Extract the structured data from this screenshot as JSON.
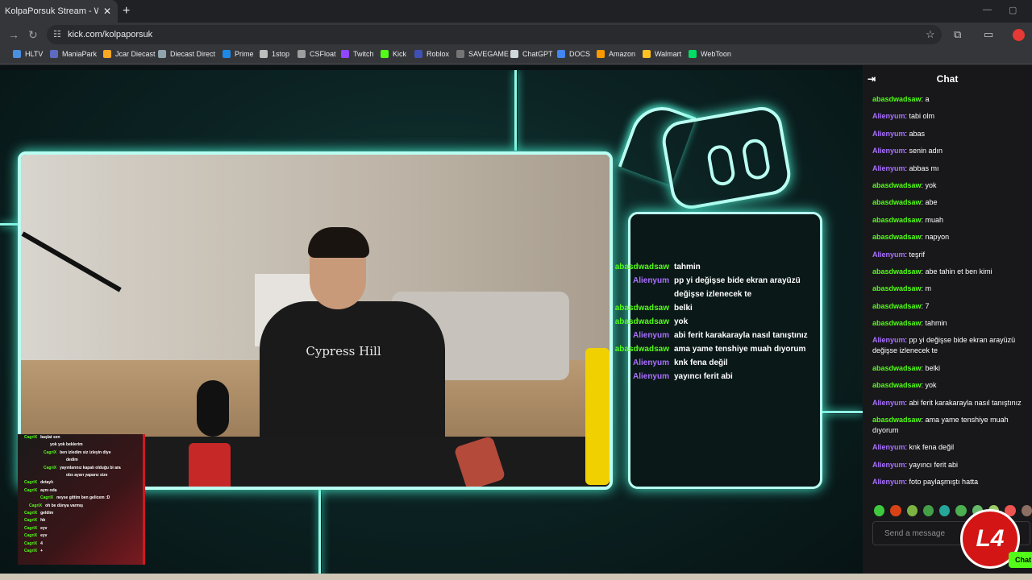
{
  "browser": {
    "tab_title": "KolpaPorsuk Stream - Watch Li",
    "new_tab_symbol": "+",
    "url": "kick.com/kolpaporsuk",
    "bookmarks": [
      {
        "label": "HLTV",
        "color": "#4a90e2"
      },
      {
        "label": "ManiaPark",
        "color": "#5c6bc0"
      },
      {
        "label": "Jcar Diecast",
        "color": "#f9a825"
      },
      {
        "label": "Diecast Direct",
        "color": "#90a4ae"
      },
      {
        "label": "Prime",
        "color": "#1e88e5"
      },
      {
        "label": "1stop",
        "color": "#bdbdbd"
      },
      {
        "label": "CSFloat",
        "color": "#9e9e9e"
      },
      {
        "label": "Twitch",
        "color": "#9146ff"
      },
      {
        "label": "Kick",
        "color": "#53fc18"
      },
      {
        "label": "Roblox",
        "color": "#3f51b5"
      },
      {
        "label": "SAVEGAME",
        "color": "#757575"
      },
      {
        "label": "ChatGPT",
        "color": "#cfd8dc"
      },
      {
        "label": "DOCS",
        "color": "#4285f4"
      },
      {
        "label": "Amazon",
        "color": "#ff9900"
      },
      {
        "label": "Walmart",
        "color": "#ffc220"
      },
      {
        "label": "WebToon",
        "color": "#00dc64"
      }
    ]
  },
  "stream": {
    "shirt_text": "Cypress Hill",
    "overlay_chat": [
      {
        "user": "abasdwadsaw",
        "color": "#53fc18",
        "msg": "tahmin"
      },
      {
        "user": "Alienyum",
        "color": "#a970ff",
        "msg": "pp yi değişse bide ekran arayüzü değişse izlenecek te"
      },
      {
        "user": "abasdwadsaw",
        "color": "#53fc18",
        "msg": "belki"
      },
      {
        "user": "abasdwadsaw",
        "color": "#53fc18",
        "msg": "yok"
      },
      {
        "user": "Alienyum",
        "color": "#a970ff",
        "msg": "abi ferit karakarayla nasıl tanıştınız"
      },
      {
        "user": "abasdwadsaw",
        "color": "#53fc18",
        "msg": "ama yame tenshiye muah dıyorum"
      },
      {
        "user": "Alienyum",
        "color": "#a970ff",
        "msg": "knk fena değil"
      },
      {
        "user": "Alienyum",
        "color": "#a970ff",
        "msg": "yayıncı ferit abi"
      }
    ],
    "mini_chat": [
      {
        "user": "CagriX",
        "msg": "başlat sen",
        "indent": 0
      },
      {
        "user": "",
        "msg": "yok yok beklerim",
        "indent": 28
      },
      {
        "user": "CagriX",
        "msg": "ben izledim siz izleyin diye",
        "indent": 24
      },
      {
        "user": "",
        "msg": "dedim",
        "indent": 48
      },
      {
        "user": "CagriX",
        "msg": "yayınlarınız kapalı olduğu bi ara",
        "indent": 24
      },
      {
        "user": "",
        "msg": "obs ayarı yaparız size",
        "indent": 48
      },
      {
        "user": "CagriX",
        "msg": "detaylı",
        "indent": 0
      },
      {
        "user": "CagriX",
        "msg": "aynı oda",
        "indent": 0
      },
      {
        "user": "CagriX",
        "msg": "neyse gittim ben gelicem :D",
        "indent": 20
      },
      {
        "user": "CagriX",
        "msg": "oh be dünya varmış",
        "indent": 6
      },
      {
        "user": "CagriX",
        "msg": "geldim",
        "indent": 0
      },
      {
        "user": "CagriX",
        "msg": "hb",
        "indent": 0
      },
      {
        "user": "CagriX",
        "msg": "eyv",
        "indent": 0
      },
      {
        "user": "CagriX",
        "msg": "eyv",
        "indent": 0
      },
      {
        "user": "CagriX",
        "msg": "4",
        "indent": 0
      },
      {
        "user": "CagriX",
        "msg": "+",
        "indent": 0
      }
    ]
  },
  "chat": {
    "title": "Chat",
    "placeholder": "Send a message",
    "chat_button": "Chat",
    "messages": [
      {
        "user": "abasdwadsaw",
        "color": "#53fc18",
        "msg": "a"
      },
      {
        "user": "Alienyum",
        "color": "#a970ff",
        "msg": "tabi olm"
      },
      {
        "user": "Alienyum",
        "color": "#a970ff",
        "msg": "abas"
      },
      {
        "user": "Alienyum",
        "color": "#a970ff",
        "msg": "senin adın"
      },
      {
        "user": "Alienyum",
        "color": "#a970ff",
        "msg": "abbas mı"
      },
      {
        "user": "abasdwadsaw",
        "color": "#53fc18",
        "msg": "yok"
      },
      {
        "user": "abasdwadsaw",
        "color": "#53fc18",
        "msg": "abe"
      },
      {
        "user": "abasdwadsaw",
        "color": "#53fc18",
        "msg": "muah"
      },
      {
        "user": "abasdwadsaw",
        "color": "#53fc18",
        "msg": "napyon"
      },
      {
        "user": "Alienyum",
        "color": "#a970ff",
        "msg": "teşrif"
      },
      {
        "user": "abasdwadsaw",
        "color": "#53fc18",
        "msg": "abe tahin et ben kimi"
      },
      {
        "user": "abasdwadsaw",
        "color": "#53fc18",
        "msg": "m"
      },
      {
        "user": "abasdwadsaw",
        "color": "#53fc18",
        "msg": "7"
      },
      {
        "user": "abasdwadsaw",
        "color": "#53fc18",
        "msg": "tahmin"
      },
      {
        "user": "Alienyum",
        "color": "#a970ff",
        "msg": "pp yi değişse bide ekran arayüzü değişse izlenecek te"
      },
      {
        "user": "abasdwadsaw",
        "color": "#53fc18",
        "msg": "belki"
      },
      {
        "user": "abasdwadsaw",
        "color": "#53fc18",
        "msg": "yok"
      },
      {
        "user": "Alienyum",
        "color": "#a970ff",
        "msg": "abi ferit karakarayla nasıl tanıştınız"
      },
      {
        "user": "abasdwadsaw",
        "color": "#53fc18",
        "msg": "ama yame tenshiye muah dıyorum"
      },
      {
        "user": "Alienyum",
        "color": "#a970ff",
        "msg": "knk fena değil"
      },
      {
        "user": "Alienyum",
        "color": "#a970ff",
        "msg": "yayıncı ferit abi"
      },
      {
        "user": "Alienyum",
        "color": "#a970ff",
        "msg": "foto paylaşmıştı hatta"
      }
    ],
    "emote_colors": [
      "#3fc93f",
      "#d84315",
      "#7cb342",
      "#43a047",
      "#26a69a",
      "#4caf50",
      "#66bb6a",
      "#9ccc65",
      "#ef5350",
      "#8d6e63"
    ]
  },
  "logo_text": "L4"
}
